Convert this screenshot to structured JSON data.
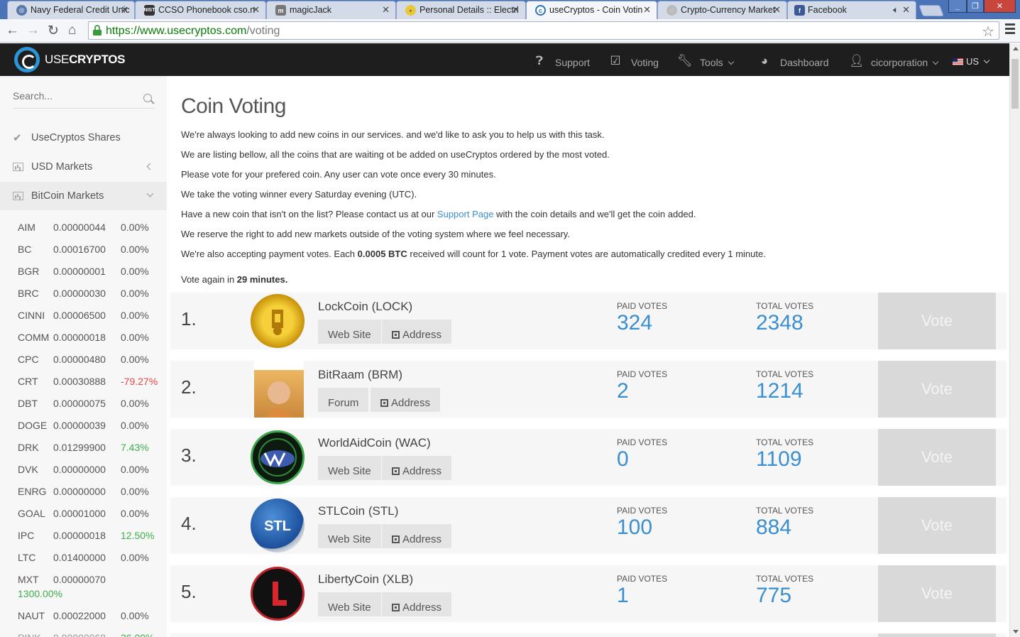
{
  "browser": {
    "tabs": [
      {
        "title": "Navy Federal Credit Unic",
        "active": false
      },
      {
        "title": "CCSO Phonebook cso.n",
        "active": false
      },
      {
        "title": "magicJack",
        "active": false
      },
      {
        "title": "Personal Details :: Electri",
        "active": false
      },
      {
        "title": "useCryptos - Coin Votin",
        "active": true
      },
      {
        "title": "Crypto-Currency Market",
        "active": false
      },
      {
        "title": "Facebook",
        "active": false
      }
    ],
    "url_base": "https://www.usecryptos.com",
    "url_path": "/voting"
  },
  "header": {
    "logo_light": "USE",
    "logo_bold": "CRYPTOS",
    "nav": {
      "support": "Support",
      "voting": "Voting",
      "tools": "Tools",
      "dashboard": "Dashboard",
      "user": "cicorporation",
      "lang": "US"
    }
  },
  "sidebar": {
    "search_placeholder": "Search...",
    "items": [
      {
        "label": "UseCryptos Shares"
      },
      {
        "label": "USD Markets"
      },
      {
        "label": "BitCoin Markets"
      }
    ],
    "markets": [
      {
        "sym": "AIM",
        "price": "0.00000044",
        "chg": "0.00%",
        "dir": ""
      },
      {
        "sym": "BC",
        "price": "0.00016700",
        "chg": "0.00%",
        "dir": ""
      },
      {
        "sym": "BGR",
        "price": "0.00000001",
        "chg": "0.00%",
        "dir": ""
      },
      {
        "sym": "BRC",
        "price": "0.00000030",
        "chg": "0.00%",
        "dir": ""
      },
      {
        "sym": "CINNI",
        "price": "0.00006500",
        "chg": "0.00%",
        "dir": ""
      },
      {
        "sym": "COMM",
        "price": "0.00000018",
        "chg": "0.00%",
        "dir": ""
      },
      {
        "sym": "CPC",
        "price": "0.00000480",
        "chg": "0.00%",
        "dir": ""
      },
      {
        "sym": "CRT",
        "price": "0.00030888",
        "chg": "-79.27%",
        "dir": "down"
      },
      {
        "sym": "DBT",
        "price": "0.00000075",
        "chg": "0.00%",
        "dir": ""
      },
      {
        "sym": "DOGE",
        "price": "0.00000039",
        "chg": "0.00%",
        "dir": ""
      },
      {
        "sym": "DRK",
        "price": "0.01299900",
        "chg": "7.43%",
        "dir": "up"
      },
      {
        "sym": "DVK",
        "price": "0.00000000",
        "chg": "0.00%",
        "dir": ""
      },
      {
        "sym": "ENRG",
        "price": "0.00000000",
        "chg": "0.00%",
        "dir": ""
      },
      {
        "sym": "GOAL",
        "price": "0.00001000",
        "chg": "0.00%",
        "dir": ""
      },
      {
        "sym": "IPC",
        "price": "0.00000018",
        "chg": "12.50%",
        "dir": "up"
      },
      {
        "sym": "LTC",
        "price": "0.01400000",
        "chg": "0.00%",
        "dir": ""
      },
      {
        "sym": "MXT",
        "price": "0.00000070",
        "chg": "1300.00%",
        "dir": "up"
      },
      {
        "sym": "NAUT",
        "price": "0.00022000",
        "chg": "0.00%",
        "dir": ""
      }
    ]
  },
  "main": {
    "title": "Coin Voting",
    "intro": [
      "We're always looking to add new coins in our services. and we'd like to ask you to help us with this task.",
      "We are listing bellow, all the coins that are waiting ot be added on useCryptos ordered by the most voted.",
      "Please vote for your prefered coin. Any user can vote once every 30 minutes.",
      "We take the voting winner every Saturday evening (UTC)."
    ],
    "contact_pre": "Have a new coin that isn't on the list? Please contact us at our ",
    "contact_link": "Support Page",
    "contact_post": " with the coin details and we'll get the coin added.",
    "reserve": "We reserve the right to add new markets outside of the voting system where we feel necessary.",
    "payment_pre": "We're also accepting payment votes. Each ",
    "payment_amount": "0.0005 BTC",
    "payment_post": " received will count for 1 vote. Payment votes are automatically credited every 1 minute.",
    "vote_again_pre": "Vote again in ",
    "vote_again_time": "29 minutes.",
    "paid_label": "PAID VOTES",
    "total_label": "TOTAL VOTES",
    "vote_label": "Vote",
    "address_label": "Address",
    "coins": [
      {
        "rank": "1.",
        "name": "LockCoin (LOCK)",
        "link": "Web Site",
        "paid": "324",
        "total": "2348"
      },
      {
        "rank": "2.",
        "name": "BitRaam (BRM)",
        "link": "Forum",
        "paid": "2",
        "total": "1214"
      },
      {
        "rank": "3.",
        "name": "WorldAidCoin (WAC)",
        "link": "Web Site",
        "paid": "0",
        "total": "1109"
      },
      {
        "rank": "4.",
        "name": "STLCoin (STL)",
        "link": "Web Site",
        "paid": "100",
        "total": "884"
      },
      {
        "rank": "5.",
        "name": "LibertyCoin (XLB)",
        "link": "Web Site",
        "paid": "1",
        "total": "775"
      }
    ]
  }
}
